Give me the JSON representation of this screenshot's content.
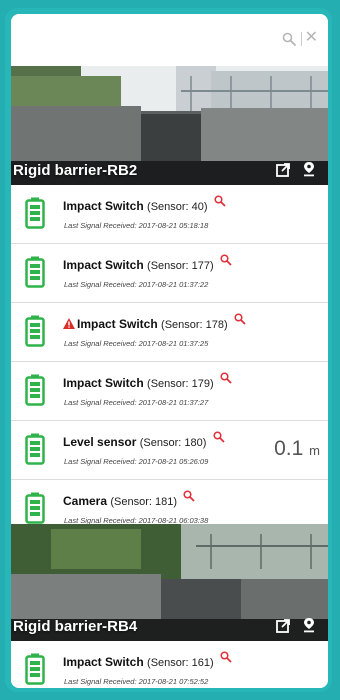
{
  "search": {
    "value": "",
    "placeholder": ""
  },
  "sites": [
    {
      "title": "Rigid barrier-RB2",
      "sensors": [
        {
          "name": "Impact Switch",
          "sensor": "(Sensor: 40)",
          "signal": "Last Signal Received: 2017-08-21 05:18:18",
          "reading": "",
          "unit": "",
          "warning": false
        },
        {
          "name": "Impact Switch",
          "sensor": "(Sensor: 177)",
          "signal": "Last Signal Received: 2017-08-21 01:37:22",
          "reading": "",
          "unit": "",
          "warning": false
        },
        {
          "name": "Impact Switch",
          "sensor": "(Sensor: 178)",
          "signal": "Last Signal Received: 2017-08-21 01:37:25",
          "reading": "",
          "unit": "",
          "warning": true
        },
        {
          "name": "Impact Switch",
          "sensor": "(Sensor: 179)",
          "signal": "Last Signal Received: 2017-08-21 01:37:27",
          "reading": "",
          "unit": "",
          "warning": false
        },
        {
          "name": "Level sensor",
          "sensor": "(Sensor: 180)",
          "signal": "Last Signal Received: 2017-08-21 05:26:09",
          "reading": "0.1",
          "unit": "m",
          "warning": false
        },
        {
          "name": "Camera",
          "sensor": "(Sensor: 181)",
          "signal": "Last Signal Received: 2017-08-21 06:03:38",
          "reading": "",
          "unit": "",
          "warning": false
        }
      ]
    },
    {
      "title": "Rigid barrier-RB4",
      "sensors": [
        {
          "name": "Impact Switch",
          "sensor": "(Sensor: 161)",
          "signal": "Last Signal Received: 2017-08-21 07:52:52",
          "reading": "",
          "unit": "",
          "warning": false
        }
      ]
    }
  ],
  "colors": {
    "accent": "#28b7b9",
    "battery": "#2fb34a",
    "zoom": "#e0303a",
    "warning": "#d9302a"
  },
  "icons": [
    "search-icon",
    "clear-icon",
    "external-link-icon",
    "map-pin-icon",
    "battery-icon",
    "zoom-icon",
    "warning-icon"
  ]
}
